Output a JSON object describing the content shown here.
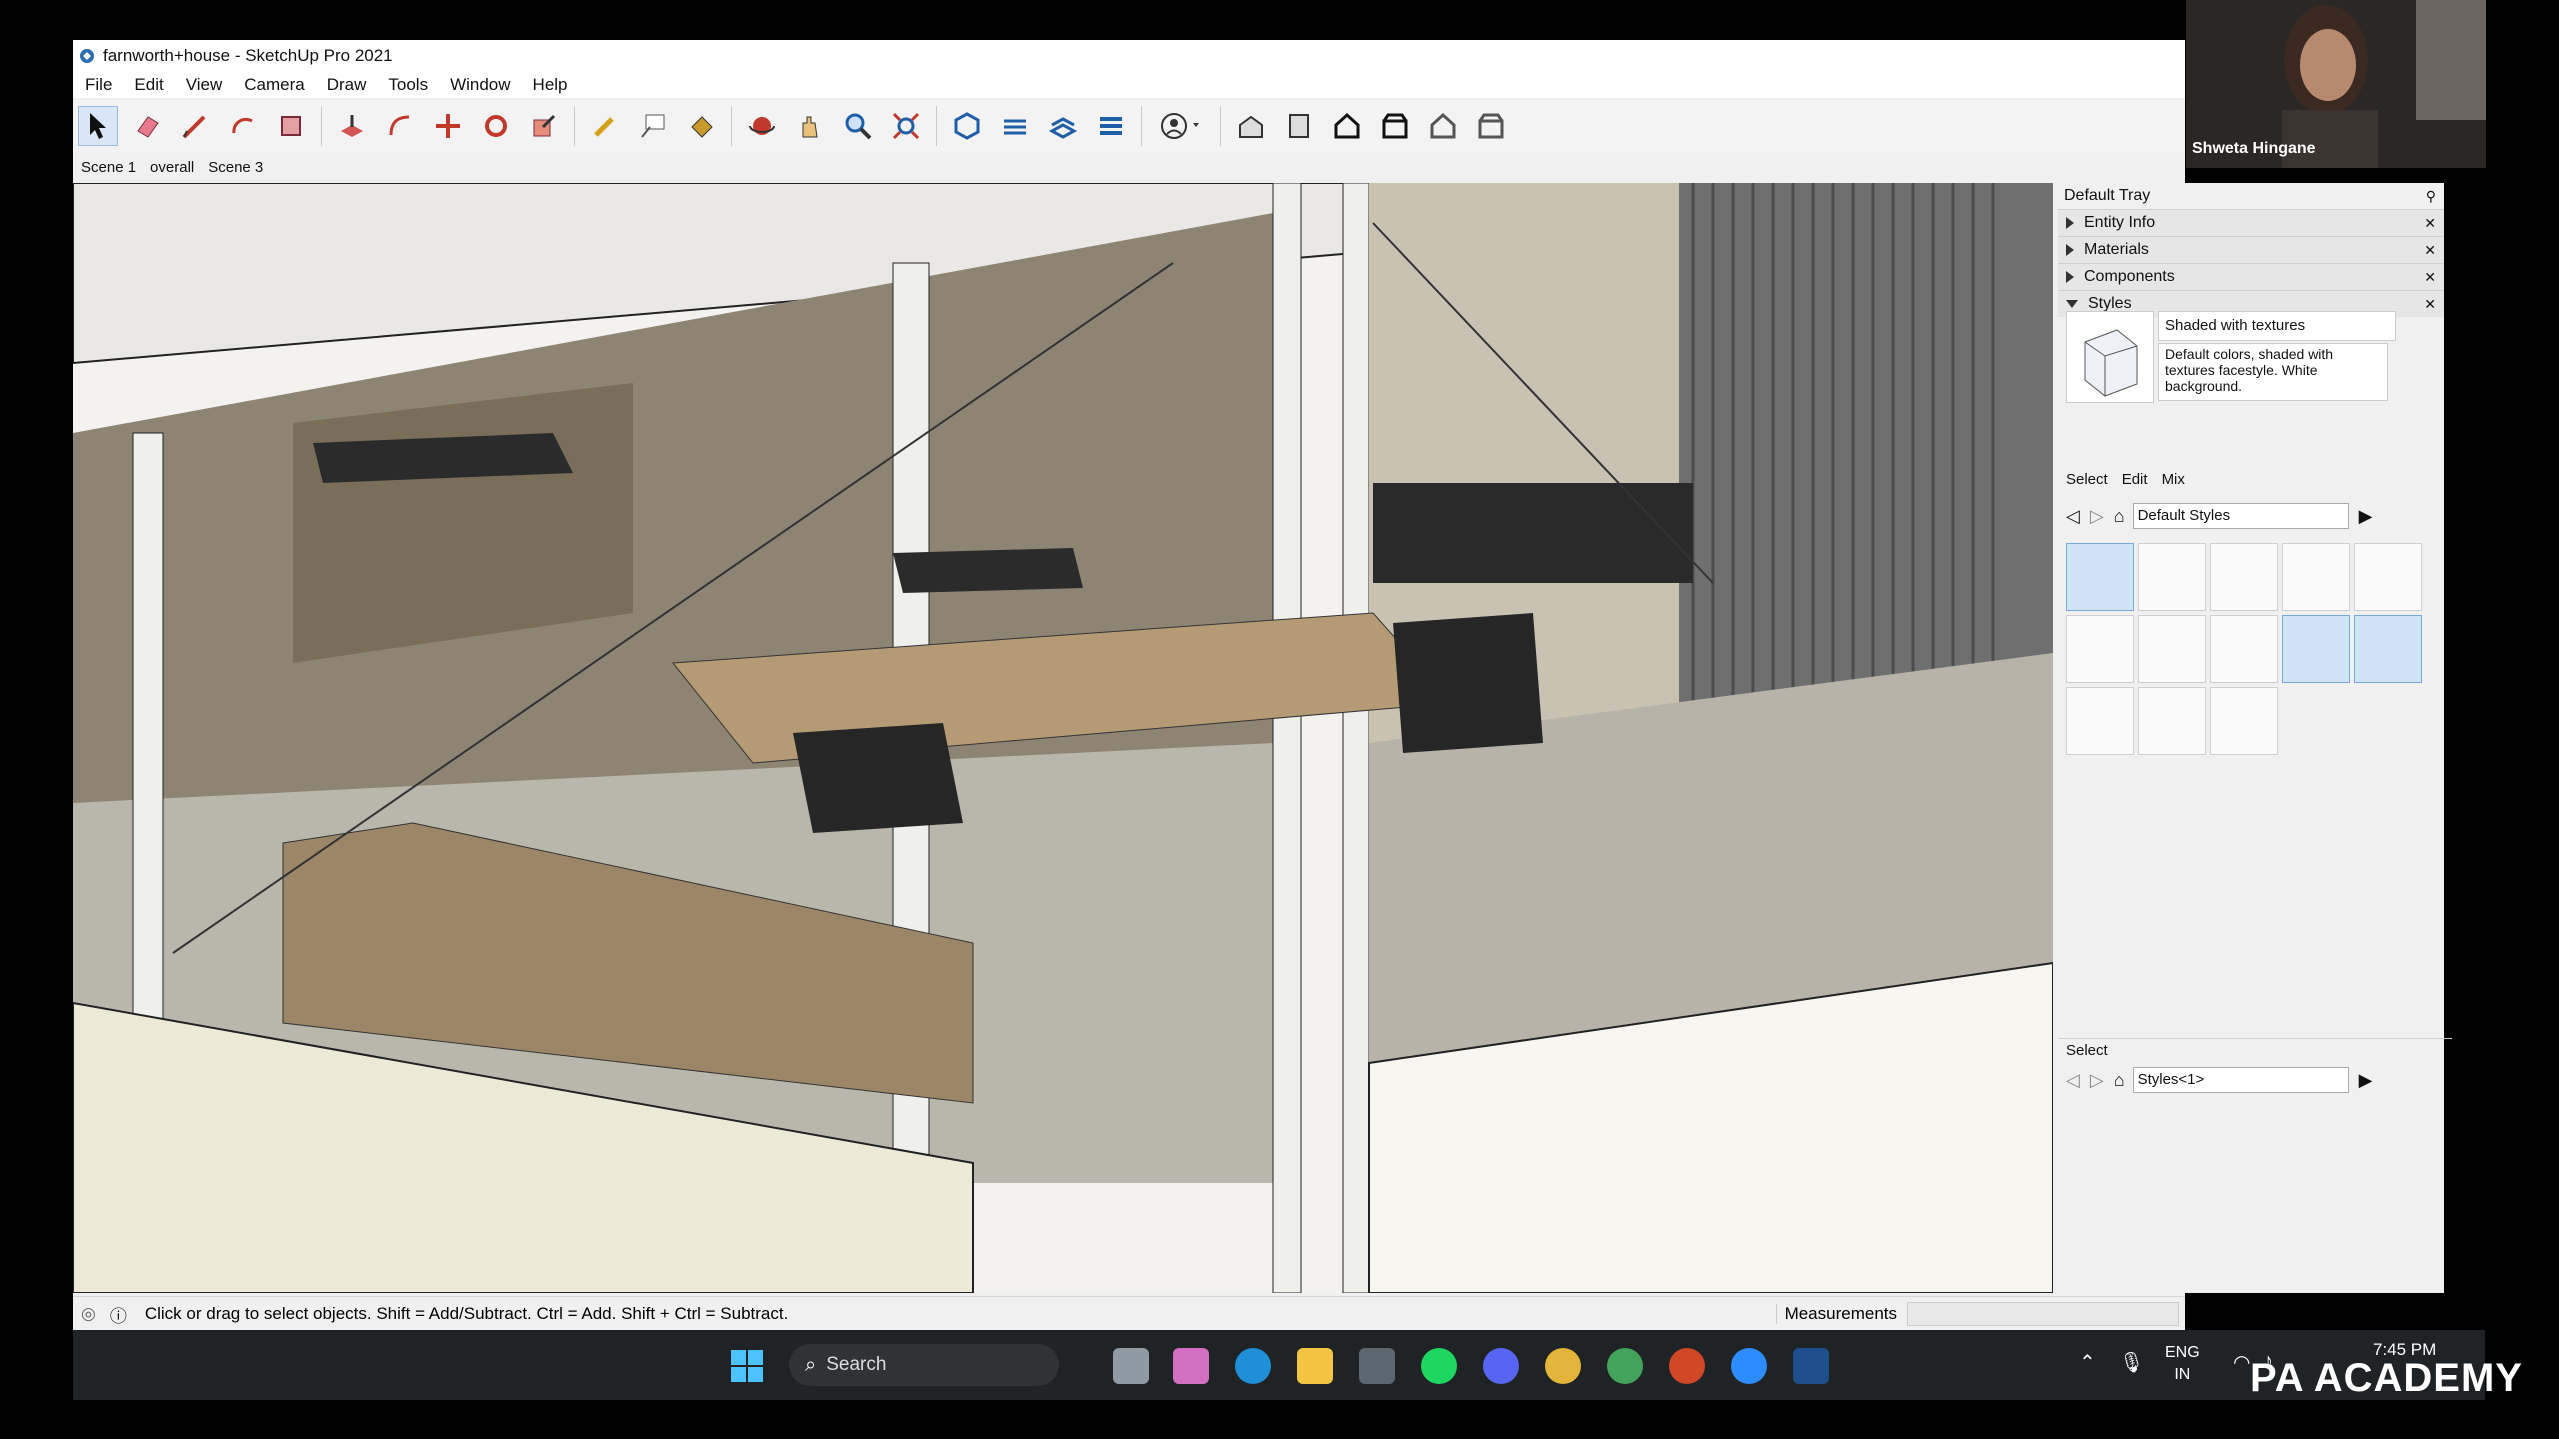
{
  "window": {
    "title": "farnworth+house - SketchUp Pro 2021"
  },
  "menu": [
    "File",
    "Edit",
    "View",
    "Camera",
    "Draw",
    "Tools",
    "Window",
    "Help"
  ],
  "scenes": [
    "Scene 1",
    "overall",
    "Scene 3"
  ],
  "tray": {
    "title": "Default Tray",
    "sections": [
      "Entity Info",
      "Materials",
      "Components",
      "Styles"
    ],
    "style": {
      "name": "Shaded with textures",
      "description": "Default colors, shaded with textures facestyle. White background."
    },
    "tabs": [
      "Select",
      "Edit",
      "Mix"
    ],
    "collection": "Default Styles",
    "bottom_label": "Select",
    "bottom_collection": "Styles<1>"
  },
  "status": {
    "hint": "Click or drag to select objects. Shift = Add/Subtract. Ctrl = Add. Shift + Ctrl = Subtract.",
    "measurements_label": "Measurements"
  },
  "taskbar": {
    "search_label": "Search",
    "lang_top": "ENG",
    "lang_bottom": "IN",
    "time": "7:45 PM"
  },
  "webcam": {
    "name": "Shweta Hingane"
  },
  "watermark": "PA ACADEMY",
  "colors": {
    "accent": "#0078d4",
    "taskbar": "#1f2326",
    "tray_selected": "#cfe3f7"
  }
}
